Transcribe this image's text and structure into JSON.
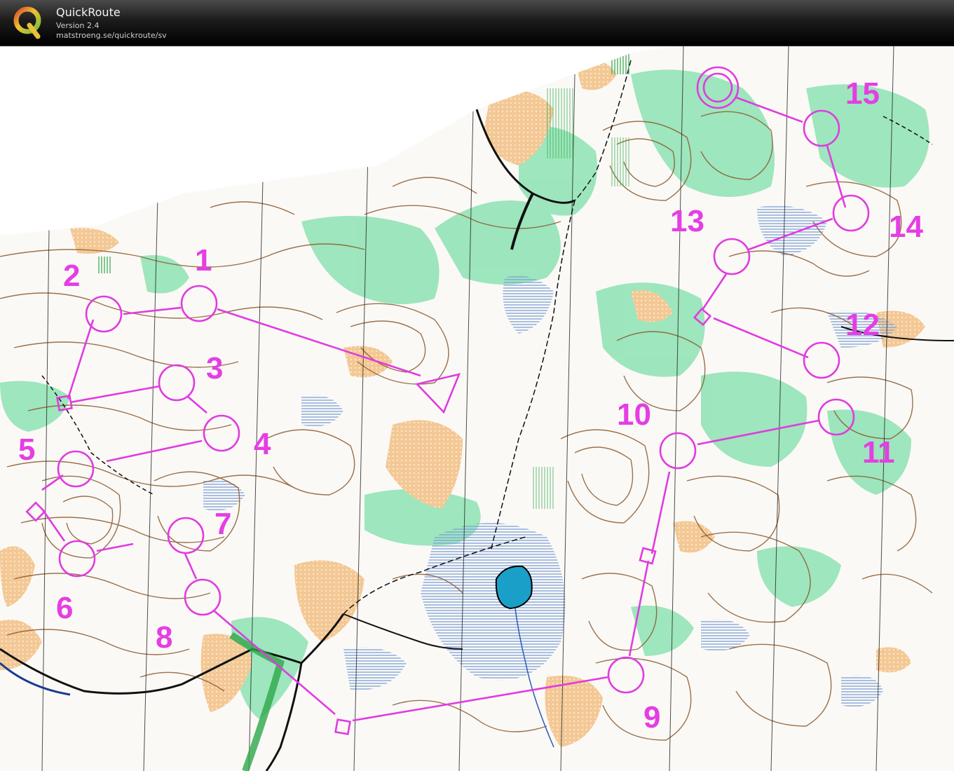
{
  "window": {
    "title": "QuickRoute",
    "version": "Version 2.4",
    "url": "matstroeng.se/quickroute/sv",
    "logo_letter": "Q"
  },
  "colors": {
    "course": "#e03be0",
    "forest_green": "#8fe2b4",
    "open_land": "#f2c08f",
    "marsh": "#7a9fd6",
    "water": "#1aa0c8",
    "contour": "#8a5a2e",
    "titlebar": "#1c1c1c"
  },
  "course": {
    "start_icon": "start-triangle-icon",
    "finish_icon": "finish-double-circle-icon",
    "controls": [
      "1",
      "2",
      "3",
      "4",
      "5",
      "6",
      "7",
      "8",
      "9",
      "10",
      "11",
      "12",
      "13",
      "14",
      "15"
    ]
  }
}
